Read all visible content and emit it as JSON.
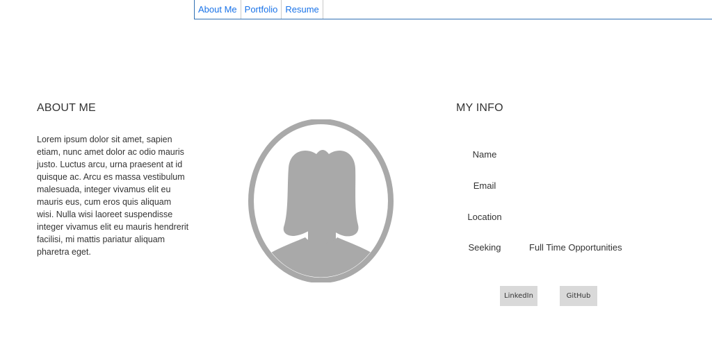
{
  "nav": {
    "items": [
      {
        "label": "About Me"
      },
      {
        "label": "Portfolio"
      },
      {
        "label": "Resume"
      }
    ]
  },
  "about": {
    "title": "ABOUT ME",
    "text": "Lorem ipsum dolor sit amet, sapien etiam, nunc amet dolor ac odio mauris justo. Luctus arcu, urna praesent at id quisque ac. Arcu es massa vestibulum malesuada, integer vivamus elit eu mauris eus, cum eros quis aliquam wisi. Nulla wisi laoreet suspendisse integer vivamus elit eu mauris hendrerit facilisi, mi mattis pariatur aliquam pharetra eget."
  },
  "avatar": {
    "icon": "person-silhouette-icon",
    "color": "#a9a9a9"
  },
  "info": {
    "title": "MY INFO",
    "rows": [
      {
        "label": "Name",
        "value": ""
      },
      {
        "label": "Email",
        "value": ""
      },
      {
        "label": "Location",
        "value": ""
      },
      {
        "label": "Seeking",
        "value": "Full Time Opportunities"
      }
    ]
  },
  "buttons": {
    "linkedin": "LinkedIn",
    "github": "GitHub"
  },
  "colors": {
    "nav_border": "#2f6fb3",
    "link": "#1a73e8",
    "button_bg": "#d9d9d9"
  }
}
